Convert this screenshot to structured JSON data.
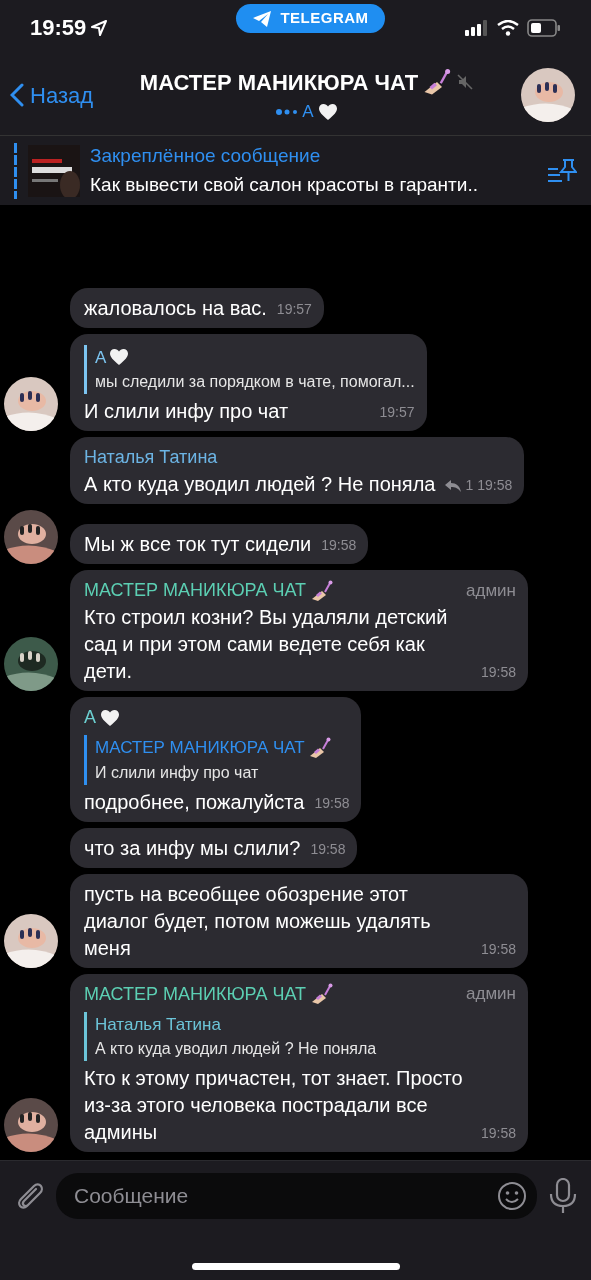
{
  "status_bar": {
    "time": "19:59",
    "app_pill": "TELEGRAM"
  },
  "header": {
    "back": "Назад",
    "title": "МАСТЕР МАНИКЮРА ЧАТ",
    "nail_emoji": true,
    "muted": true,
    "typing": "А",
    "heart_emoji": true
  },
  "pinned": {
    "title": "Закреплённое сообщение",
    "text": "Как вывести свой салон красоты в гаранти.."
  },
  "messages": [
    {
      "text": "жаловалось на вас.",
      "time": "19:57",
      "avatar": false
    },
    {
      "reply": {
        "name": "А",
        "heart_emoji": true,
        "color": "#7cc4f0",
        "text": "мы следили за порядком в чате, помогал..."
      },
      "text": "И слили инфу про чат",
      "time": "19:57",
      "avatar": true
    },
    {
      "sender": {
        "name": "Наталья Татина",
        "color": "#6cb4e4"
      },
      "text": "А кто куда уводил людей ? Не поняла",
      "time": "19:58",
      "replies": "1",
      "avatar": false
    },
    {
      "text": "Мы ж все ток тут сидели",
      "time": "19:58",
      "avatar": true
    },
    {
      "sender": {
        "name": "МАСТЕР МАНИКЮРА ЧАТ",
        "nail_emoji": true,
        "color": "#5ccfb3"
      },
      "role": "админ",
      "text": "Кто строил козни? Вы удаляли детский сад и при этом сами ведете себя как дети.",
      "time": "19:58",
      "avatar": true
    },
    {
      "sender": {
        "name": "А",
        "heart_emoji": true,
        "color": "#6ccfd0"
      },
      "reply": {
        "name": "МАСТЕР МАНИКЮРА ЧАТ",
        "nail_emoji": true,
        "color": "#2f8ff0",
        "text": "И слили инфу про чат"
      },
      "text": "подробнее, пожалуйста",
      "time": "19:58",
      "avatar": false
    },
    {
      "text": "что за инфу мы слили?",
      "time": "19:58",
      "avatar": false
    },
    {
      "text": "пусть на всеобщее обозрение этот диалог будет, потом можешь удалять меня",
      "time": "19:58",
      "avatar": true
    },
    {
      "sender": {
        "name": "МАСТЕР МАНИКЮРА ЧАТ",
        "nail_emoji": true,
        "color": "#5ccfb3"
      },
      "role": "админ",
      "reply": {
        "name": "Наталья Татина",
        "color": "#6cc4d8",
        "text": "А кто куда уводил людей ? Не поняла"
      },
      "text": "Кто к этому причастен, тот знает. Просто из-за этого человека пострадали все админы",
      "time": "19:58",
      "avatar": true
    }
  ],
  "composer": {
    "placeholder": "Сообщение"
  }
}
